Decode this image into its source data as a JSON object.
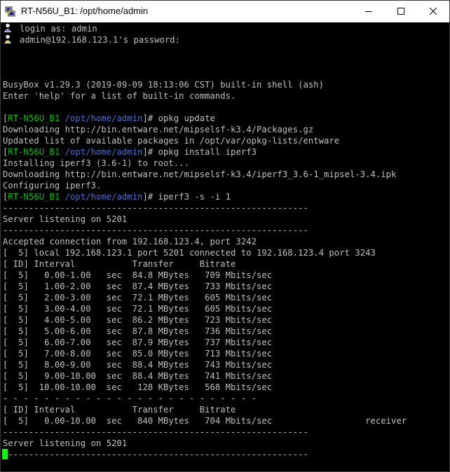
{
  "window": {
    "title": "RT-N56U_B1: /opt/home/admin",
    "controls": {
      "minimize": "minimize-icon",
      "maximize": "maximize-icon",
      "close": "close-icon"
    }
  },
  "colors": {
    "prompt_host": "#00c000",
    "prompt_path": "#4a6fd8",
    "text": "#c0c0c0",
    "cursor": "#00ff00"
  },
  "terminal": {
    "login": [
      "login as: admin",
      "admin@192.168.123.1's password:"
    ],
    "busybox": [
      "BusyBox v1.29.3 (2019-09-09 18:13:06 CST) built-in shell (ash)",
      "Enter 'help' for a list of built-in commands."
    ],
    "prompt": {
      "open": "[",
      "host": "RT-N56U_B1",
      "path": "/opt/home/admin",
      "close": "]#"
    },
    "cmd1": " opkg update",
    "cmd1_output": [
      "Downloading http://bin.entware.net/mipselsf-k3.4/Packages.gz",
      "Updated list of available packages in /opt/var/opkg-lists/entware"
    ],
    "cmd2": " opkg install iperf3",
    "cmd2_output": [
      "Installing iperf3 (3.6-1) to root...",
      "Downloading http://bin.entware.net/mipselsf-k3.4/iperf3_3.6-1_mipsel-3.4.ipk",
      "Configuring iperf3."
    ],
    "cmd3": " iperf3 -s -i 1",
    "iperf_output": [
      "-----------------------------------------------------------",
      "Server listening on 5201",
      "-----------------------------------------------------------",
      "Accepted connection from 192.168.123.4, port 3242",
      "[  5] local 192.168.123.1 port 5201 connected to 192.168.123.4 port 3243",
      "[ ID] Interval           Transfer     Bitrate",
      "[  5]   0.00-1.00   sec  84.8 MBytes   709 Mbits/sec",
      "[  5]   1.00-2.00   sec  87.4 MBytes   733 Mbits/sec",
      "[  5]   2.00-3.00   sec  72.1 MBytes   605 Mbits/sec",
      "[  5]   3.00-4.00   sec  72.1 MBytes   605 Mbits/sec",
      "[  5]   4.00-5.00   sec  86.2 MBytes   723 Mbits/sec",
      "[  5]   5.00-6.00   sec  87.8 MBytes   736 Mbits/sec",
      "[  5]   6.00-7.00   sec  87.9 MBytes   737 Mbits/sec",
      "[  5]   7.00-8.00   sec  85.0 MBytes   713 Mbits/sec",
      "[  5]   8.00-9.00   sec  88.4 MBytes   743 Mbits/sec",
      "[  5]   9.00-10.00  sec  88.4 MBytes   741 Mbits/sec",
      "[  5]  10.00-10.00  sec   128 KBytes   568 Mbits/sec",
      "- - - - - - - - - - - - - - - - - - - - - - - - -",
      "[ ID] Interval           Transfer     Bitrate",
      "[  5]   0.00-10.00  sec   840 MBytes   704 Mbits/sec                  receiver",
      "-----------------------------------------------------------",
      "Server listening on 5201",
      "-----------------------------------------------------------"
    ]
  }
}
